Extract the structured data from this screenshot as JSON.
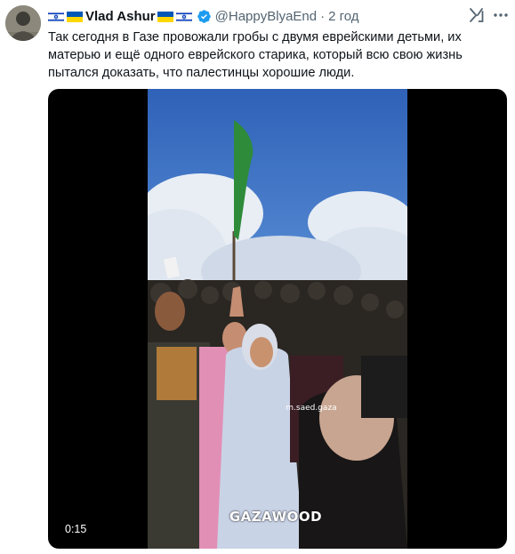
{
  "author": {
    "name": "Vlad Ashur",
    "handle": "@HappyBlyaEnd",
    "time_ago": "2 год",
    "verified": true,
    "flags": [
      "israel-flag",
      "ukraine-flag",
      "ukraine-flag",
      "israel-flag"
    ]
  },
  "post": {
    "text": "Так сегодня в Газе провожали гробы с двумя еврейскими детьми, их матерью и ещё одного еврейского старика, который всю свою жизнь пытался доказать, что палестинцы хорошие люди."
  },
  "media": {
    "duration": "0:15",
    "watermark_handle": "m.saed.gaza",
    "watermark_brand": "GAZAWOOD"
  },
  "icons": {
    "verified": "verified-badge-icon",
    "grok": "grok-icon",
    "more": "more-icon"
  },
  "colors": {
    "text": "#0f1419",
    "secondary": "#536471",
    "verified": "#1d9bf0",
    "media_bg": "#000000"
  }
}
